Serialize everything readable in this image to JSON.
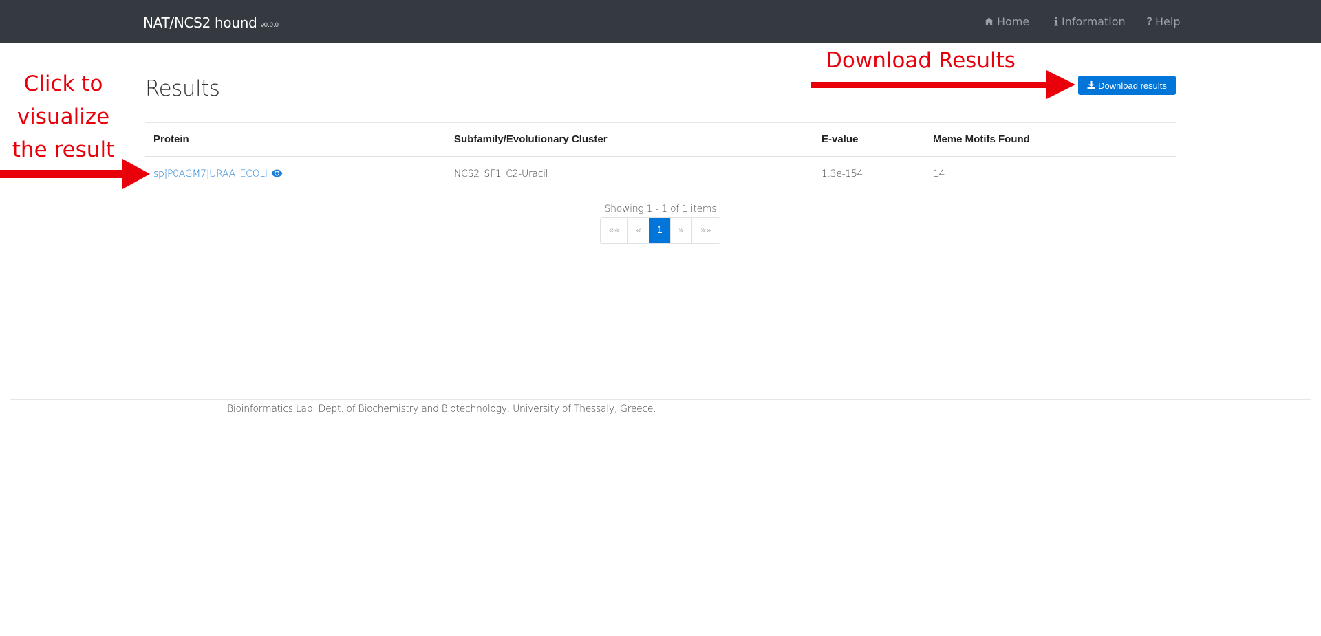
{
  "navbar": {
    "brand": "NAT/NCS2 hound",
    "version": "v0.0.0",
    "items": [
      {
        "label": "Home",
        "icon": "home-icon"
      },
      {
        "label": "Information",
        "icon": "info-icon"
      },
      {
        "label": "Help",
        "icon": "question-icon"
      }
    ]
  },
  "page": {
    "title": "Results",
    "download_label": "Download results"
  },
  "table": {
    "headers": [
      "Protein",
      "Subfamily/Evolutionary Cluster",
      "E-value",
      "Meme Motifs Found"
    ],
    "rows": [
      {
        "protein": "sp|P0AGM7|URAA_ECOLI",
        "subfamily": "NCS2_SF1_C2-Uracil",
        "evalue": "1.3e-154",
        "motifs": "14"
      }
    ],
    "summary": "Showing 1 - 1 of 1 items."
  },
  "pagination": {
    "first": "««",
    "prev": "«",
    "current": "1",
    "next": "»",
    "last": "»»"
  },
  "footer": {
    "text": "Bioinformatics Lab, Dept. of Biochemistry and Biotechnology, University of Thessaly, Greece."
  },
  "annotations": {
    "left_lines": [
      "Click to",
      "visualize",
      "the result"
    ],
    "right": "Download Results",
    "arrow_color": "#e8000b"
  },
  "colors": {
    "navbar_bg": "#343a40",
    "primary": "#0275d8",
    "link": "#1f7fd8"
  }
}
